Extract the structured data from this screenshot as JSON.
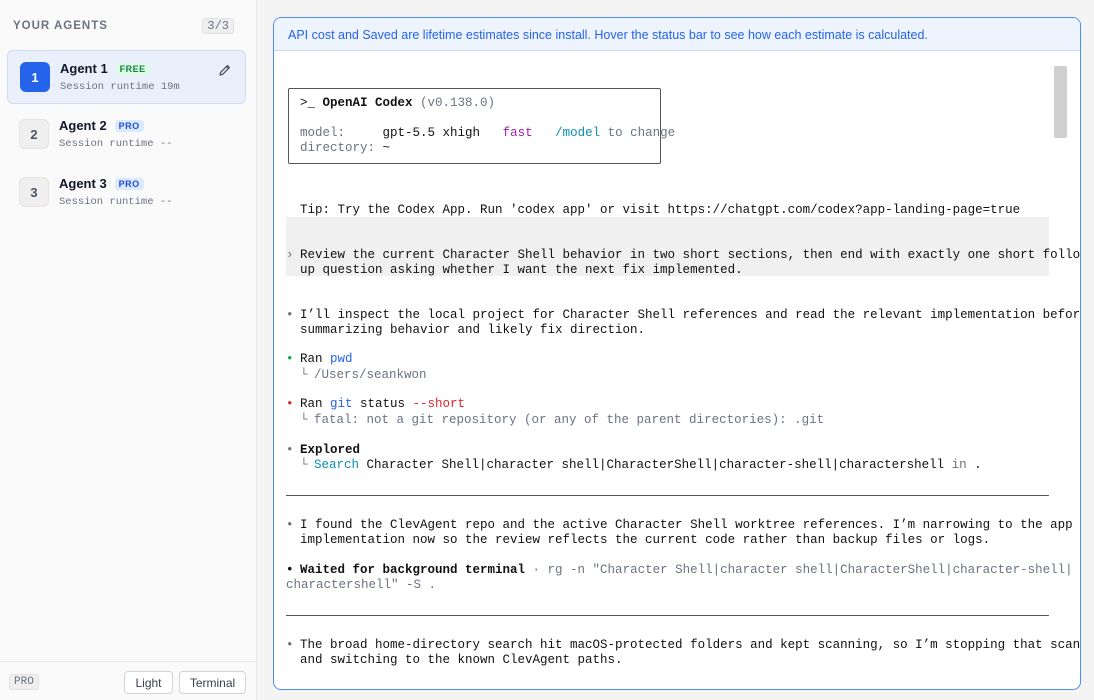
{
  "sidebar": {
    "title": "YOUR AGENTS",
    "count": "3/3",
    "agents": [
      {
        "number": "1",
        "name": "Agent 1",
        "badge": "FREE",
        "session": "Session runtime 19m"
      },
      {
        "number": "2",
        "name": "Agent 2",
        "badge": "PRO",
        "session": "Session runtime --"
      },
      {
        "number": "3",
        "name": "Agent 3",
        "badge": "PRO",
        "session": "Session runtime --"
      }
    ],
    "footer": {
      "plan": "PRO",
      "light_label": "Light",
      "terminal_label": "Terminal"
    }
  },
  "notice": "API cost and Saved are lifetime estimates since install. Hover the status bar to see how each estimate is calculated.",
  "terminal": {
    "header": {
      "title_prefix": ">_ ",
      "title": "OpenAI Codex",
      "version": " (v0.138.0)",
      "model_label": "model:     ",
      "model_value": "gpt-5.5 xhigh",
      "model_fast": "fast",
      "model_cmd": "/model",
      "model_suffix": " to change",
      "dir_label": "directory: ",
      "dir_value": "~"
    },
    "tip": "Tip: Try the Codex App. Run 'codex app' or visit https://chatgpt.com/codex?app-landing-page=true",
    "prompt_marker": "›",
    "prompt_line1": "Review the current Character Shell behavior in two short sections, then end with exactly one short follow-",
    "prompt_line2": "up question asking whether I want the next fix implemented.",
    "bullet": "•",
    "tree": "└",
    "msg1_line1": "I’ll inspect the local project for Character Shell references and read the relevant implementation before",
    "msg1_line2": "summarizing behavior and likely fix direction.",
    "ran_label": "Ran ",
    "ran1_cmd": "pwd",
    "ran1_out": "/Users/seankwon",
    "ran2_cmd": "git",
    "ran2_arg": " status ",
    "ran2_flag": "--short",
    "ran2_out": "fatal: not a git repository (or any of the parent directories): .git",
    "explored_label": "Explored",
    "search_label": "Search",
    "search_query": " Character Shell|character shell|CharacterShell|character-shell|charactershell",
    "search_in": " in ",
    "search_path": ".",
    "msg2_line1": "I found the ClevAgent repo and the active Character Shell worktree references. I’m narrowing to the app",
    "msg2_line2": "implementation now so the review reflects the current code rather than backup files or logs.",
    "waited_label": "Waited for background terminal",
    "waited_cmd1": " · rg -n \"Character Shell|character shell|CharacterShell|character-shell|",
    "waited_cmd2": "charactershell\" -S .",
    "msg3_line1": "The broad home-directory search hit macOS-protected folders and kept scanning, so I’m stopping that scan",
    "msg3_line2": "and switching to the known ClevAgent paths."
  },
  "colors": {
    "accent": "#2563eb",
    "panel_border": "#4c8ff0",
    "success": "#16a34a",
    "error": "#dc2626"
  }
}
